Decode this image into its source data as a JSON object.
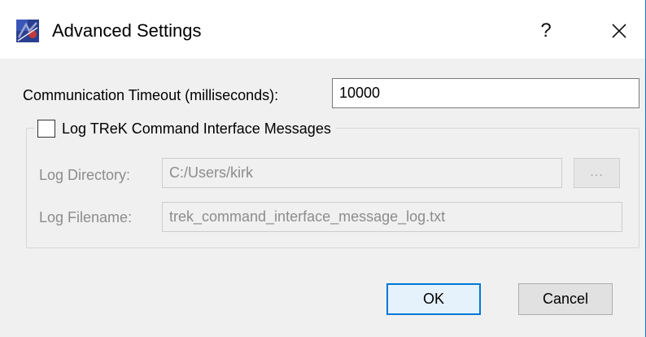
{
  "window": {
    "title": "Advanced Settings",
    "help_label": "?",
    "icon": "trek-app-icon",
    "close_icon": "close-icon"
  },
  "form": {
    "timeout_label": "Communication Timeout (milliseconds):",
    "timeout_value": "10000"
  },
  "log_group": {
    "checkbox_label": "Log TReK Command Interface Messages",
    "checked": false,
    "directory_label": "Log Directory:",
    "directory_value": "C:/Users/kirk",
    "browse_label": "...",
    "filename_label": "Log Filename:",
    "filename_value": "trek_command_interface_message_log.txt"
  },
  "buttons": {
    "ok_label": "OK",
    "cancel_label": "Cancel"
  },
  "colors": {
    "accent": "#0078d7",
    "dialog_bg": "#f0f0f0",
    "disabled_text": "#8c8c8c"
  }
}
